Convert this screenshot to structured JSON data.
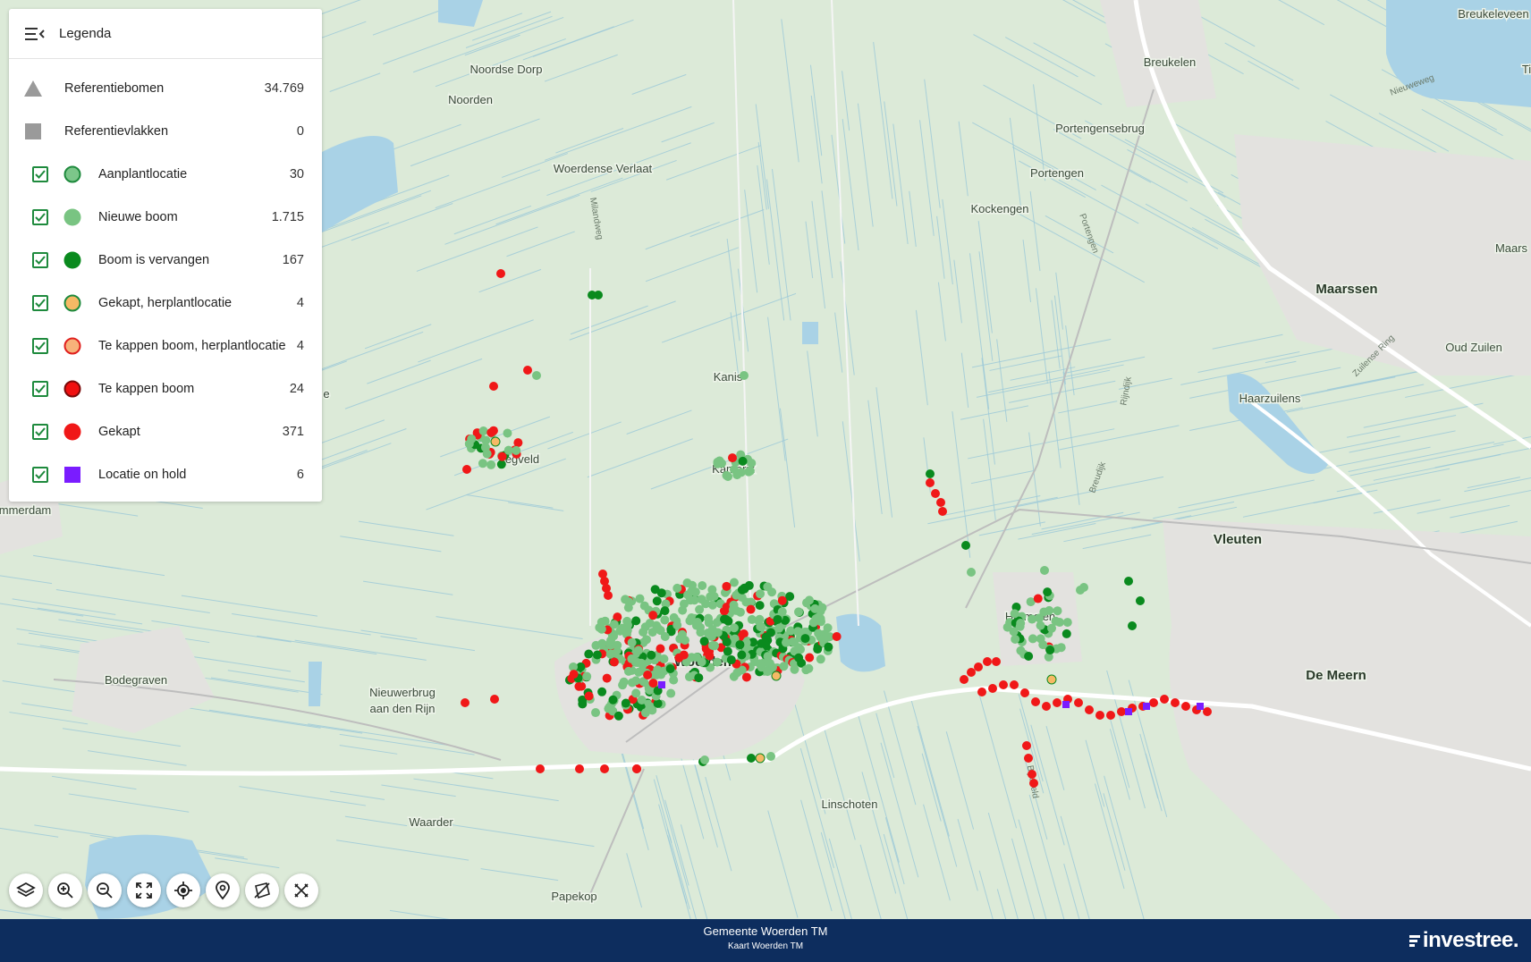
{
  "legend": {
    "title": "Legenda",
    "items": [
      {
        "label": "Referentiebomen",
        "count": "34.769",
        "symbol": "triangle",
        "color": "#9a9a9a",
        "checkbox": false
      },
      {
        "label": "Referentievlakken",
        "count": "0",
        "symbol": "square",
        "color": "#9a9a9a",
        "checkbox": false
      },
      {
        "label": "Aanplantlocatie",
        "count": "30",
        "symbol": "circle-outline",
        "color": "#7cc68a",
        "stroke": "#1e8a3d",
        "checkbox": true
      },
      {
        "label": "Nieuwe boom",
        "count": "1.715",
        "symbol": "circle",
        "color": "#79c482",
        "checkbox": true
      },
      {
        "label": "Boom is vervangen",
        "count": "167",
        "symbol": "circle",
        "color": "#0a8a1e",
        "checkbox": true
      },
      {
        "label": "Gekapt, herplantlocatie",
        "count": "4",
        "symbol": "circle-outline",
        "color": "#f6b965",
        "stroke": "#1e8a3d",
        "checkbox": true
      },
      {
        "label": "Te kappen boom, herplantlocatie",
        "count": "4",
        "symbol": "circle-outline",
        "color": "#f7b27a",
        "stroke": "#e0201e",
        "checkbox": true
      },
      {
        "label": "Te kappen boom",
        "count": "24",
        "symbol": "circle-outline",
        "color": "#f01010",
        "stroke": "#7a0a0a",
        "checkbox": true
      },
      {
        "label": "Gekapt",
        "count": "371",
        "symbol": "circle",
        "color": "#f01818",
        "checkbox": true
      },
      {
        "label": "Locatie on hold",
        "count": "6",
        "symbol": "square",
        "color": "#7a1cff",
        "checkbox": true
      }
    ]
  },
  "toolbar": [
    {
      "name": "layers-icon"
    },
    {
      "name": "zoom-in-icon"
    },
    {
      "name": "zoom-out-icon"
    },
    {
      "name": "fullscreen-icon"
    },
    {
      "name": "locate-icon"
    },
    {
      "name": "marker-icon"
    },
    {
      "name": "measure-area-icon"
    },
    {
      "name": "measure-tools-icon"
    }
  ],
  "map": {
    "places": [
      {
        "name": "Breukelen",
        "size": "normal"
      },
      {
        "name": "Breukeleveen",
        "size": "normal"
      },
      {
        "name": "Noordse Dorp",
        "size": "normal"
      },
      {
        "name": "Noorden",
        "size": "normal"
      },
      {
        "name": "Portengensebrug",
        "size": "normal"
      },
      {
        "name": "Woerdense Verlaat",
        "size": "normal"
      },
      {
        "name": "Portengen",
        "size": "normal"
      },
      {
        "name": "Kockengen",
        "size": "normal"
      },
      {
        "name": "Maarssen",
        "size": "big"
      },
      {
        "name": "Oud Zuilen",
        "size": "normal"
      },
      {
        "name": "Kanis",
        "size": "normal"
      },
      {
        "name": "Haarzuilens",
        "size": "normal"
      },
      {
        "name": "Zegveld",
        "size": "normal"
      },
      {
        "name": "Vleuten",
        "size": "big"
      },
      {
        "name": "Harmelen",
        "size": "normal"
      },
      {
        "name": "Woerden",
        "size": "big"
      },
      {
        "name": "De Meern",
        "size": "big"
      },
      {
        "name": "Bodegraven",
        "size": "normal"
      },
      {
        "name": "Nieuwerbrug",
        "size": "normal"
      },
      {
        "name": "aan den Rijn",
        "size": "normal"
      },
      {
        "name": "Linschoten",
        "size": "normal"
      },
      {
        "name": "Waarder",
        "size": "normal"
      },
      {
        "name": "Papekop",
        "size": "normal"
      },
      {
        "name": "mmerdam",
        "size": "normal"
      },
      {
        "name": "Ti",
        "size": "normal"
      },
      {
        "name": "Maars",
        "size": "normal"
      },
      {
        "name": "Kamerik",
        "size": "normal"
      },
      {
        "name": "e",
        "size": "normal"
      }
    ],
    "roads": [
      "Milandweg",
      "Portengen",
      "Rijndijk",
      "Breudijk",
      "Zuilense Ring",
      "Nieuweweg",
      "Bijleveld"
    ],
    "colors": {
      "land": "#dcead8",
      "water": "#a9d2e6",
      "urban": "#e3e2df",
      "road": "#ffffff",
      "ditch": "#9cc9d8"
    }
  },
  "footer": {
    "title": "Gemeente Woerden TM",
    "subtitle": "Kaart Woerden TM",
    "logo": "investree."
  }
}
